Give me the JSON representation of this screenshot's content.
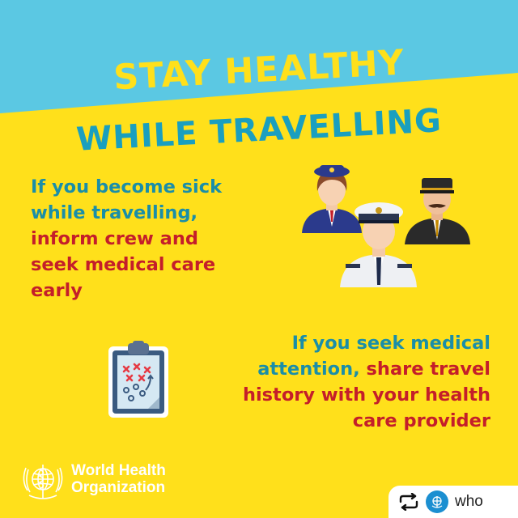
{
  "title": {
    "line1": "STAY HEALTHY",
    "line2": "WHILE TRAVELLING"
  },
  "message1": {
    "line1": "If you become sick",
    "line2": "while travelling,",
    "line3": "inform crew and",
    "line4": "seek medical care",
    "line5": "early"
  },
  "message2": {
    "line1": "If you seek medical",
    "line2a": "attention,",
    "line2b": " share travel",
    "line3": "history with your health",
    "line4": "care provider"
  },
  "organization": {
    "name_line1": "World Health",
    "name_line2": "Organization"
  },
  "repost": {
    "handle": "who",
    "icon": "repost-icon"
  },
  "colors": {
    "background_yellow": "#ffe01b",
    "banner_blue": "#5bc8e3",
    "teal_text": "#1a8ea8",
    "red_text": "#c41e2a"
  },
  "icons": [
    "flight-attendant-icon",
    "pilot-icon",
    "captain-icon",
    "clipboard-icon",
    "who-emblem-icon"
  ]
}
